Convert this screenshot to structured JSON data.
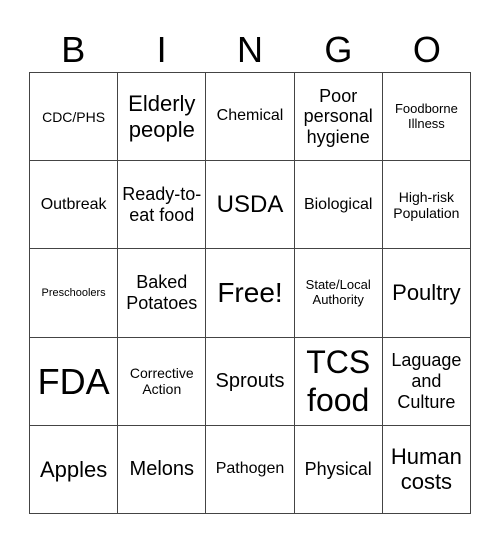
{
  "header": {
    "letters": [
      "B",
      "I",
      "N",
      "G",
      "O"
    ]
  },
  "cells": [
    [
      "CDC/PHS",
      "Elderly people",
      "Chemical",
      "Poor personal hygiene",
      "Foodborne Illness"
    ],
    [
      "Outbreak",
      "Ready-to-eat food",
      "USDA",
      "Biological",
      "High-risk Population"
    ],
    [
      "Preschoolers",
      "Baked Potatoes",
      "Free!",
      "State/Local Authority",
      "Poultry"
    ],
    [
      "FDA",
      "Corrective Action",
      "Sprouts",
      "TCS food",
      "Laguage and Culture"
    ],
    [
      "Apples",
      "Melons",
      "Pathogen",
      "Physical",
      "Human costs"
    ]
  ]
}
